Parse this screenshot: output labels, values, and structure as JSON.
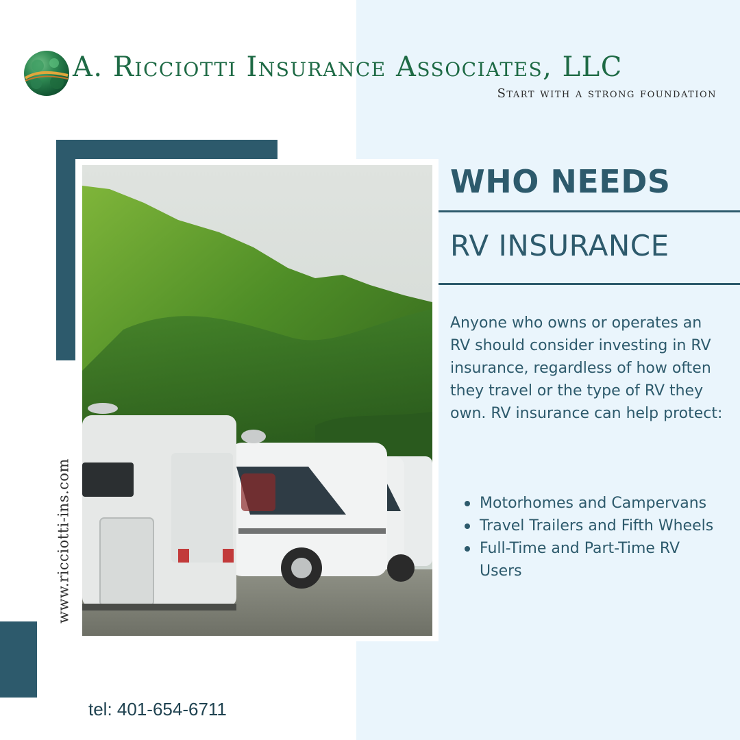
{
  "brand": {
    "name": "A. Ricciotti Insurance Associates, LLC",
    "tagline": "Start with a strong foundation",
    "logo_icon": "green-gemstone-swirl-logo-icon"
  },
  "heading": {
    "line1": "WHO NEEDS",
    "line2": "RV INSURANCE"
  },
  "body": "Anyone who owns or operates an RV should consider investing in RV insurance, regardless of how often they travel or the type of RV they own. RV insurance can help protect:",
  "bullets": [
    "Motorhomes and Campervans",
    "Travel Trailers and Fifth Wheels",
    "Full-Time and Part-Time RV Users"
  ],
  "website": "www.ricciotti-ins.com",
  "phone": "tel: 401-654-6711",
  "colors": {
    "accent": "#2d5a6c",
    "panel": "#eaf5fc",
    "brand_green": "#1e6a45"
  }
}
